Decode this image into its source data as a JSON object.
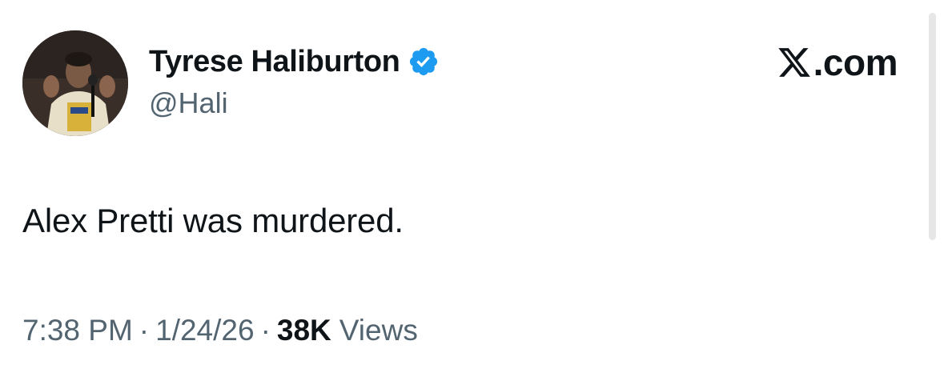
{
  "author": {
    "display_name": "Tyrese Haliburton",
    "handle": "@Hali",
    "verified": true
  },
  "brand": {
    "domain": "X.com",
    "domain_suffix": ".com"
  },
  "tweet": {
    "text": "Alex Pretti was murdered."
  },
  "meta": {
    "time": "7:38 PM",
    "separator": "·",
    "date": "1/24/26",
    "views_count": "38K",
    "views_label": "Views"
  },
  "colors": {
    "text_primary": "#0f1419",
    "text_secondary": "#536471",
    "verified_blue": "#1d9bf0"
  },
  "icons": {
    "verified": "verified-badge-icon",
    "brand": "x-logo-icon"
  }
}
